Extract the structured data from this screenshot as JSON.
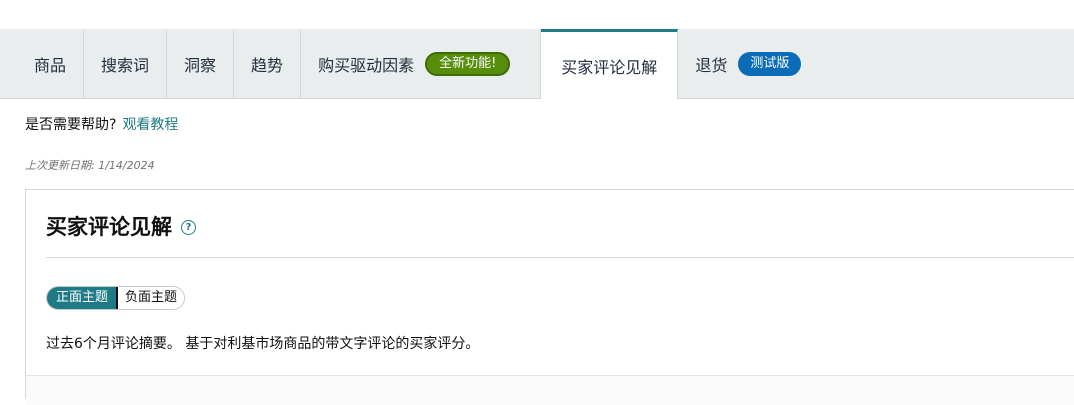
{
  "tabs": [
    {
      "label": "商品"
    },
    {
      "label": "搜索词"
    },
    {
      "label": "洞察"
    },
    {
      "label": "趋势"
    },
    {
      "label": "购买驱动因素",
      "badge": "全新功能!"
    },
    {
      "label": "买家评论见解",
      "active": true
    },
    {
      "label": "退货",
      "badge": "测试版"
    }
  ],
  "help": {
    "question": "是否需要帮助?",
    "link": "观看教程"
  },
  "last_updated": "上次更新日期: 1/14/2024",
  "card": {
    "title": "买家评论见解",
    "info_icon": "?",
    "toggle": {
      "positive": "正面主题",
      "negative": "负面主题"
    },
    "description": "过去6个月评论摘要。 基于对利基市场商品的带文字评论的买家评分。"
  },
  "colors": {
    "accent": "#1e7a85",
    "badge_new": "#568e0b",
    "badge_beta": "#0a6bb7",
    "tabbar_bg": "#eaeded"
  }
}
